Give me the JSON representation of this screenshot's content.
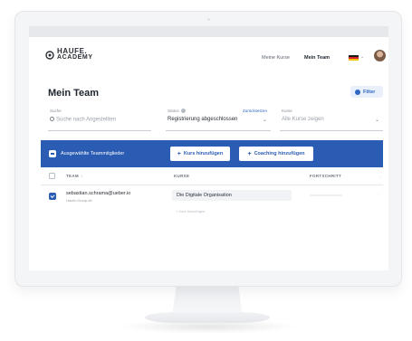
{
  "header": {
    "logo_line1": "HAUFE.",
    "logo_line2": "ACADEMY",
    "nav": [
      "Meine Kurse",
      "Mein Team"
    ]
  },
  "page": {
    "title": "Mein Team",
    "filter_label": "Filter"
  },
  "filters": {
    "search": {
      "label": "Suche",
      "placeholder": "Suche nach Angestellten"
    },
    "status": {
      "label": "Status",
      "reset": "Zurücksetzen",
      "value": "Registrierung abgeschlossen"
    },
    "kurse": {
      "label": "Kurse",
      "placeholder": "Alle Kurse zeigen"
    }
  },
  "action_bar": {
    "label": "Ausgewählte Teammitglieder",
    "add_course": "Kurs hinzufügen",
    "add_coaching": "Coaching hinzufügen"
  },
  "table": {
    "columns": [
      "TEAM",
      "KURSE",
      "FORTSCHRITT"
    ],
    "rows": [
      {
        "email": "sebastian.schrama@ueber.io",
        "company": "Haufe-Group.de",
        "course": "Die Digitale Organisation",
        "add_course": "Kurs hinzufügen"
      }
    ]
  },
  "colors": {
    "primary": "#2b5cb4",
    "text": "#1f2630"
  }
}
